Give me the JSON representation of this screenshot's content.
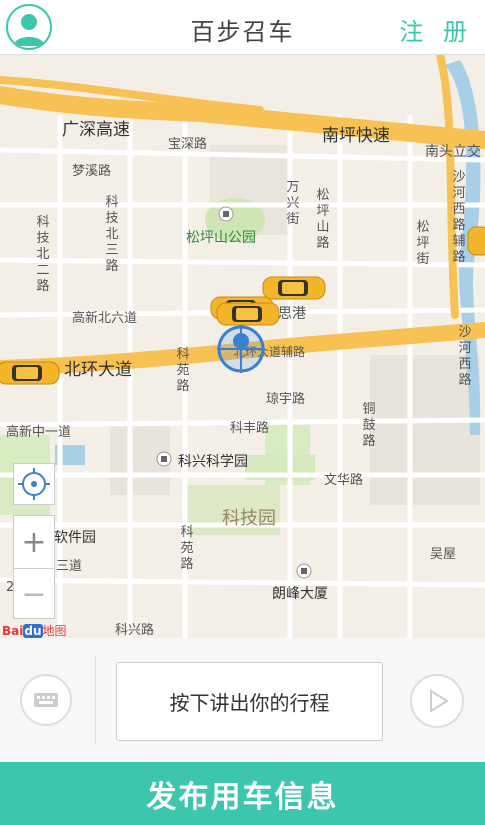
{
  "header": {
    "title": "百步召车",
    "register_label": "注 册"
  },
  "map": {
    "labels": {
      "guangshen": "广深高速",
      "nanping": "南坪快速",
      "nantou": "南头立交",
      "baoshen": "宝深路",
      "mengxi": "梦溪路",
      "wanxing": "万兴街",
      "songping_shan_road": "松坪山路",
      "songping_park": "松坪山公园",
      "keji_bei2": "科技北二路",
      "keji_bei3": "科技北三路",
      "shahe_xi_fu": "沙河西路辅路",
      "songping_jie": "松坪街",
      "gaoxin_bei6": "高新北六道",
      "sigang": "思港",
      "beihuan": "北环大道",
      "beihuan_fu": "北环大道辅路",
      "keyuan_1": "科苑路",
      "shahe_xi": "沙河西路",
      "qiongyu": "琼宇路",
      "gaoxin_zhong1": "高新中一道",
      "kefeng": "科丰路",
      "tonggu": "铜鼓路",
      "kexing": "科兴科学园",
      "wenhua": "文华路",
      "kejiyuan": "科技园",
      "ruanjian": "软件园",
      "sandao": "三道",
      "keyuan_2": "科苑路",
      "wuwu": "吴屋",
      "langfeng": "朗峰大厦",
      "kesheng": "科兴路",
      "two": "2"
    },
    "zoom_in": "+",
    "zoom_out": "−",
    "logo_bai": "Bai",
    "logo_du": "du",
    "logo_map": "地图"
  },
  "bottom": {
    "speak_label": "按下讲出你的行程"
  },
  "publish_label": "发布用车信息",
  "colors": {
    "accent": "#3cc6ad",
    "road_major": "#f7c154",
    "park": "#cfe5b6",
    "water": "#a7cfe8"
  }
}
